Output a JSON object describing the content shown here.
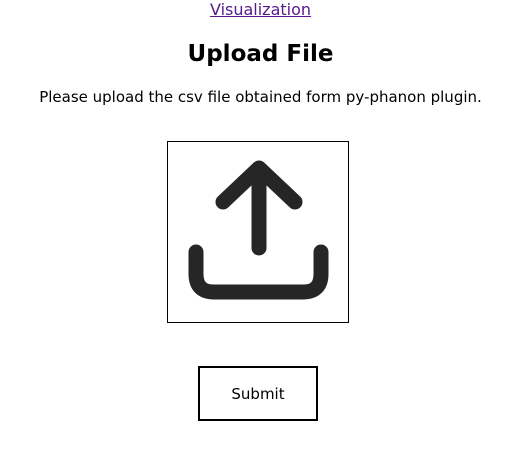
{
  "nav": {
    "link_label": "Visualization"
  },
  "main": {
    "title": "Upload File",
    "instruction": "Please upload the csv file obtained form py-phanon plugin.",
    "upload_icon": "upload-arrow-icon",
    "submit_label": "Submit"
  }
}
